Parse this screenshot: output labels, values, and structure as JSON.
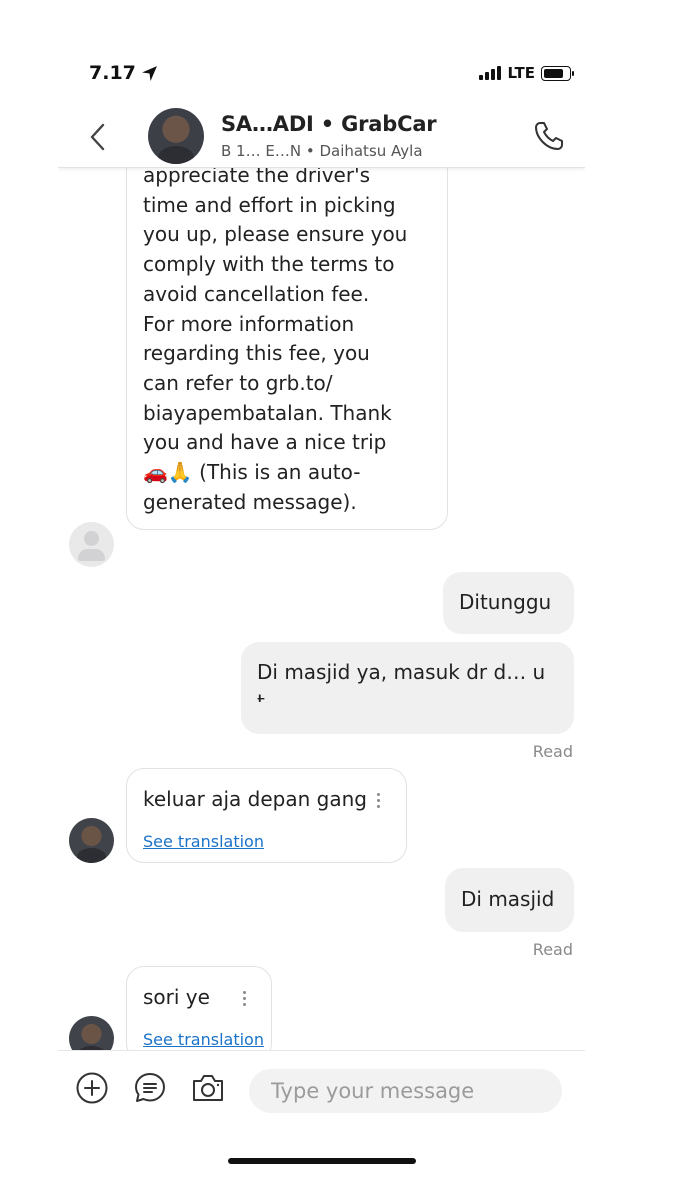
{
  "status_bar": {
    "time": "7.17",
    "network": "LTE",
    "battery_level": 0.8,
    "signal_bars": 4
  },
  "header": {
    "title": "SA…ADI • GrabCar",
    "subtitle": "B 1… E…N • Daihatsu Ayla"
  },
  "messages": [
    {
      "id": "auto",
      "lines": [
        "appreciate the driver's",
        "time and effort in picking",
        "you up, please ensure you",
        "comply with the terms to",
        "avoid cancellation fee.",
        "For more information",
        "regarding this fee, you",
        "can refer to grb.to/",
        "biayapembatalan. Thank",
        "you and have a nice trip",
        "🚗🙏 (This is an auto-",
        "generated message)."
      ]
    },
    {
      "id": "out1",
      "text": "Ditunggu"
    },
    {
      "id": "out2",
      "line1": "Di masjid ya, masuk dr d… u",
      "line2": "t…",
      "status": "Read"
    },
    {
      "id": "in1",
      "text": "keluar aja depan gang",
      "link": "See translation"
    },
    {
      "id": "out3",
      "text": "Di masjid",
      "status": "Read"
    },
    {
      "id": "in2",
      "text": "sori ye",
      "link": "See translation"
    }
  ],
  "input": {
    "placeholder": "Type your message"
  },
  "icons": [
    "back-icon",
    "call-icon",
    "add-icon",
    "quick-reply-icon",
    "camera-icon",
    "location-arrow-icon"
  ]
}
